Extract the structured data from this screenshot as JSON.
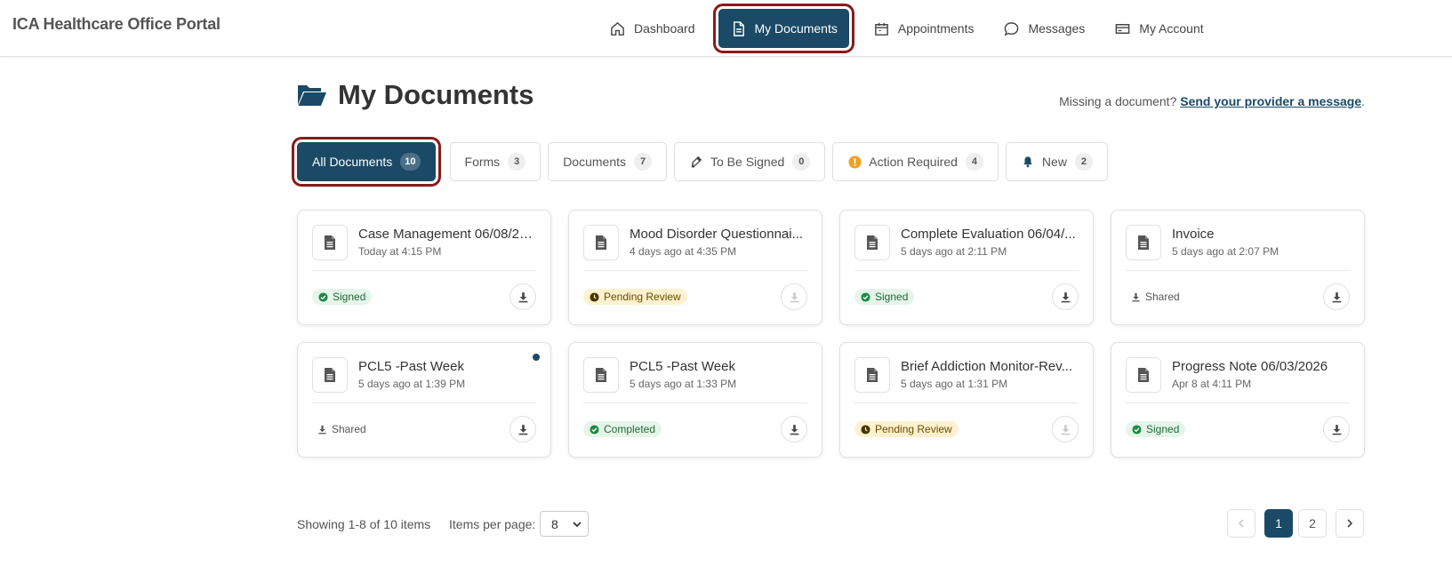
{
  "brand": "ICA Healthcare Office Portal",
  "nav": [
    {
      "label": "Dashboard",
      "icon": "home-icon"
    },
    {
      "label": "My Documents",
      "icon": "document-icon",
      "active": true
    },
    {
      "label": "Appointments",
      "icon": "calendar-icon"
    },
    {
      "label": "Messages",
      "icon": "chat-icon"
    },
    {
      "label": "My Account",
      "icon": "card-icon"
    }
  ],
  "page": {
    "title": "My Documents",
    "missing_text": "Missing a document?",
    "missing_link": "Send your provider a message",
    "missing_end": "."
  },
  "tabs": [
    {
      "label": "All Documents",
      "count": "10",
      "active": true
    },
    {
      "label": "Forms",
      "count": "3"
    },
    {
      "label": "Documents",
      "count": "7"
    },
    {
      "label": "To Be Signed",
      "count": "0",
      "icon": "pen-icon"
    },
    {
      "label": "Action Required",
      "count": "4",
      "icon": "alert-icon"
    },
    {
      "label": "New",
      "count": "2",
      "icon": "bell-icon"
    }
  ],
  "documents": [
    {
      "title": "Case Management 06/08/20...",
      "date": "Today at 4:15 PM",
      "status": "Signed",
      "status_type": "signed",
      "download_enabled": true
    },
    {
      "title": "Mood Disorder Questionnai...",
      "date": "4 days ago at 4:35 PM",
      "status": "Pending Review",
      "status_type": "pending",
      "download_enabled": false
    },
    {
      "title": "Complete Evaluation 06/04/...",
      "date": "5 days ago at 2:11 PM",
      "status": "Signed",
      "status_type": "signed",
      "download_enabled": true
    },
    {
      "title": "Invoice",
      "date": "5 days ago at 2:07 PM",
      "status": "Shared",
      "status_type": "shared",
      "download_enabled": true
    },
    {
      "title": "PCL5 -Past Week",
      "date": "5 days ago at 1:39 PM",
      "status": "Shared",
      "status_type": "shared",
      "download_enabled": true,
      "is_new": true
    },
    {
      "title": "PCL5 -Past Week",
      "date": "5 days ago at 1:33 PM",
      "status": "Completed",
      "status_type": "signed",
      "download_enabled": true
    },
    {
      "title": "Brief Addiction Monitor-Rev...",
      "date": "5 days ago at 1:31 PM",
      "status": "Pending Review",
      "status_type": "pending",
      "download_enabled": false
    },
    {
      "title": "Progress Note 06/03/2026",
      "date": "Apr 8 at 4:11 PM",
      "status": "Signed",
      "status_type": "signed",
      "download_enabled": true
    }
  ],
  "footer": {
    "showing": "Showing 1-8 of 10 items",
    "items_per_page_label": "Items per page:",
    "items_per_page_value": "8",
    "pages": [
      "1",
      "2"
    ],
    "current_page": "1"
  },
  "colors": {
    "primary": "#1a4a66",
    "highlight": "#8b1a1a",
    "signed_bg": "#e6f5ea",
    "pending_bg": "#fdf1cf"
  }
}
